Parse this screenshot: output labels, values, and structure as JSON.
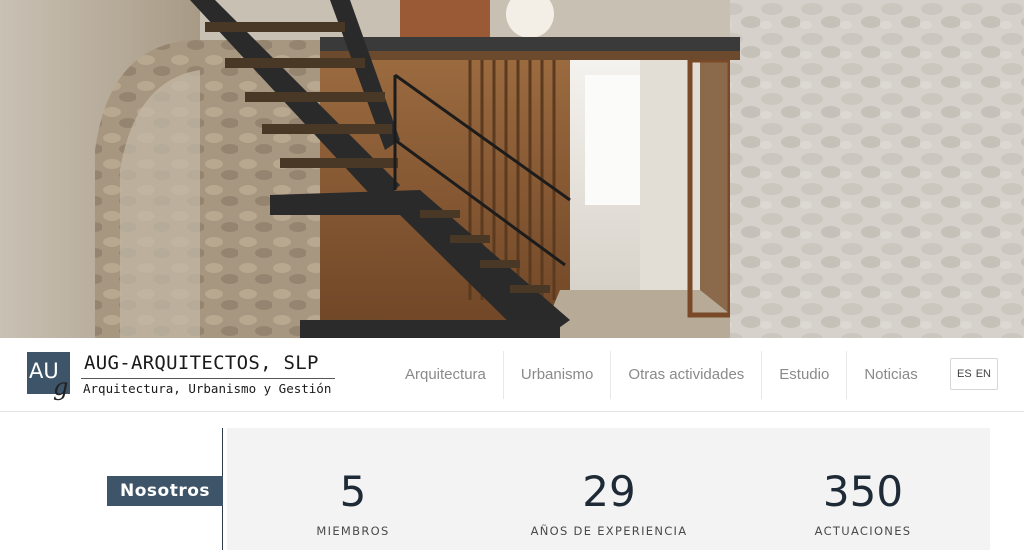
{
  "hero": {
    "image_alt": "Interior con escalera de madera y muro de piedra"
  },
  "brand": {
    "logo_au": "AU",
    "logo_g": "g",
    "name": "AUG-ARQUITECTOS, SLP",
    "tagline": "Arquitectura, Urbanismo y Gestión"
  },
  "nav": {
    "items": [
      {
        "label": "Arquitectura"
      },
      {
        "label": "Urbanismo"
      },
      {
        "label": "Otras actividades"
      },
      {
        "label": "Estudio"
      },
      {
        "label": "Noticias"
      }
    ]
  },
  "lang": {
    "es": "ES",
    "en": "EN"
  },
  "about": {
    "badge": "Nosotros",
    "stats": [
      {
        "value": "5",
        "label": "MIEMBROS"
      },
      {
        "value": "29",
        "label": "AÑOS DE EXPERIENCIA"
      },
      {
        "value": "350",
        "label": "ACTUACIONES"
      }
    ]
  },
  "colors": {
    "brand_blue": "#3e5468",
    "stat_bg": "#f3f3f3",
    "nav_text": "#8a8a8a"
  }
}
